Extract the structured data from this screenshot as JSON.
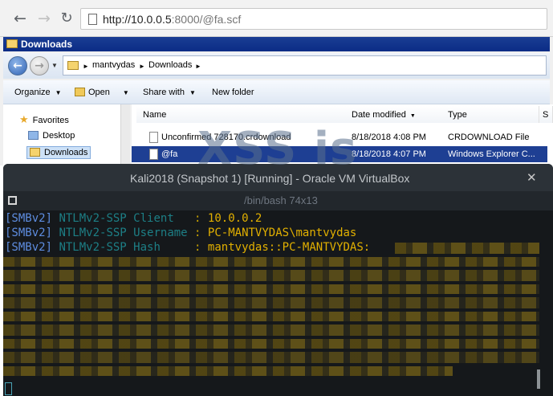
{
  "browser": {
    "back_icon": "arrow-left-icon",
    "forward_icon": "arrow-right-icon",
    "reload_icon": "reload-icon",
    "url_host": "http://10.0.0.5",
    "url_rest": ":8000/@fa.scf"
  },
  "explorer": {
    "title": "Downloads",
    "breadcrumb": [
      "mantvydas",
      "Downloads"
    ],
    "toolbar": {
      "organize": "Organize",
      "open": "Open",
      "share_with": "Share with",
      "new_folder": "New folder"
    },
    "nav": {
      "favorites": "Favorites",
      "desktop": "Desktop",
      "downloads": "Downloads"
    },
    "columns": {
      "name": "Name",
      "date_modified": "Date modified",
      "type": "Type",
      "size": "S"
    },
    "files": [
      {
        "name": "Unconfirmed 728170.crdownload",
        "date": "8/18/2018 4:08 PM",
        "type": "CRDOWNLOAD File"
      },
      {
        "name": "@fa",
        "date": "8/18/2018 4:07 PM",
        "type": "Windows Explorer C..."
      }
    ]
  },
  "overlay_text": "XSS is",
  "vbox": {
    "title": "Kali2018 (Snapshot 1) [Running] - Oracle VM VirtualBox",
    "close_icon": "close-icon",
    "terminal_title": "/bin/bash 74x13"
  },
  "terminal": {
    "lines": [
      {
        "tag": "[SMBv2]",
        "label": "NTLMv2-SSP Client  ",
        "colon": ":",
        "value": "10.0.0.2"
      },
      {
        "tag": "[SMBv2]",
        "label": "NTLMv2-SSP Username",
        "colon": ":",
        "value": "PC-MANTVYDAS\\mantvydas"
      },
      {
        "tag": "[SMBv2]",
        "label": "NTLMv2-SSP Hash    ",
        "colon": ":",
        "value": "mantvydas::PC-MANTVYDAS:"
      }
    ]
  },
  "colors": {
    "tag": "#5e8de0",
    "label": "#1d7f86",
    "value": "#e2b000",
    "terminal_bg": "#15181b",
    "selection": "#1e3f93"
  }
}
